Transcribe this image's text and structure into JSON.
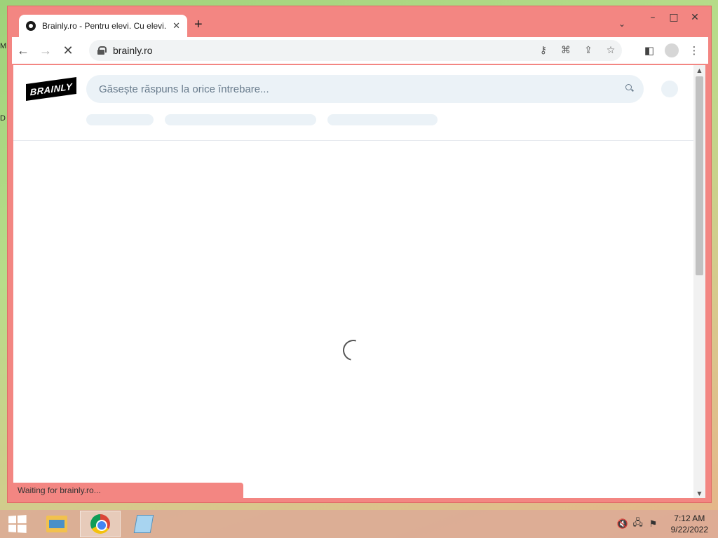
{
  "desktop": {
    "edge_labels": [
      "M",
      "D"
    ]
  },
  "window": {
    "controls": {
      "minimize": "–",
      "maximize": "□",
      "close": "✕"
    }
  },
  "tab": {
    "title": "Brainly.ro - Pentru elevi. Cu elevi.",
    "close_symbol": "✕"
  },
  "new_tab_symbol": "+",
  "tab_menu_symbol": "⌄",
  "toolbar": {
    "back": "←",
    "forward": "→",
    "stop": "✕",
    "url": "brainly.ro",
    "omni_icons": [
      "key-icon",
      "translate-icon",
      "share-icon",
      "star-icon"
    ],
    "right_icons": [
      "side-panel-icon",
      "profile-icon",
      "menu-icon"
    ]
  },
  "page": {
    "logo_text": "BRAINLY",
    "search_placeholder": "Găsește răspuns la orice întrebare...",
    "status_text": "Waiting for brainly.ro..."
  },
  "taskbar": {
    "apps": [
      "file-explorer",
      "google-chrome",
      "notepad"
    ],
    "active_app": "google-chrome",
    "time": "7:12 AM",
    "date": "9/22/2022"
  }
}
